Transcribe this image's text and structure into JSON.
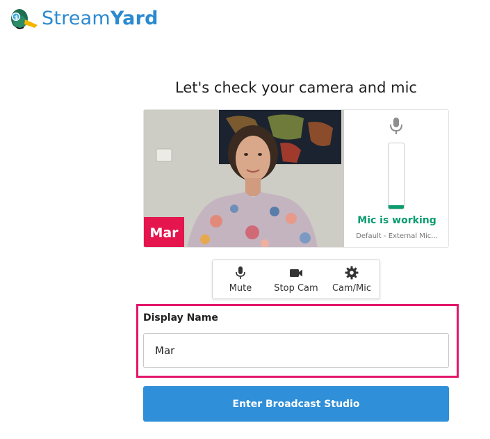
{
  "brand": {
    "name_regular": "Stream",
    "name_bold": "Yard",
    "color": "#2a8ad0"
  },
  "page": {
    "heading": "Let's check your camera and mic"
  },
  "preview": {
    "name_tag": "Mar",
    "name_tag_color": "#e5154d",
    "mic": {
      "status": "Mic is working",
      "device": "Default - External Mic...",
      "level_fraction": 0.05,
      "status_color": "#0a9c6e"
    }
  },
  "controls": [
    {
      "icon": "mic-icon",
      "label": "Mute"
    },
    {
      "icon": "camera-icon",
      "label": "Stop Cam"
    },
    {
      "icon": "gear-icon",
      "label": "Cam/Mic"
    }
  ],
  "display_name": {
    "label": "Display Name",
    "value": "Mar"
  },
  "highlight_color": "#e3166a",
  "enter_button": {
    "label": "Enter Broadcast Studio",
    "color": "#2f8fd8"
  }
}
